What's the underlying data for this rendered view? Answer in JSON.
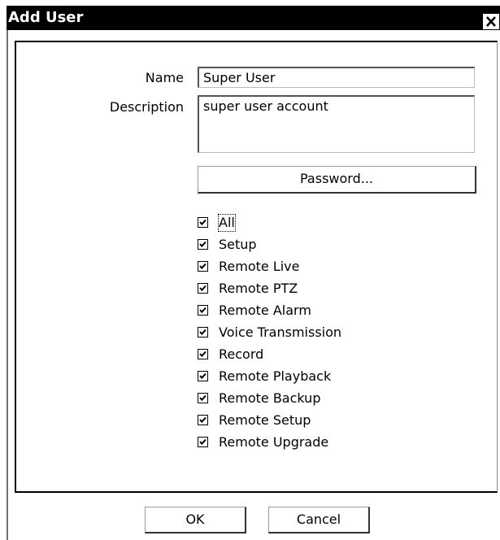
{
  "window": {
    "title": "Add User",
    "close_icon": "close-icon"
  },
  "form": {
    "name_label": "Name",
    "name_value": "Super User",
    "description_label": "Description",
    "description_value": "super user account",
    "password_button": "Password..."
  },
  "permissions": [
    {
      "label": "All",
      "checked": true
    },
    {
      "label": "Setup",
      "checked": true
    },
    {
      "label": "Remote Live",
      "checked": true
    },
    {
      "label": "Remote PTZ",
      "checked": true
    },
    {
      "label": "Remote Alarm",
      "checked": true
    },
    {
      "label": "Voice Transmission",
      "checked": true
    },
    {
      "label": "Record",
      "checked": true
    },
    {
      "label": "Remote Playback",
      "checked": true
    },
    {
      "label": "Remote Backup",
      "checked": true
    },
    {
      "label": "Remote Setup",
      "checked": true
    },
    {
      "label": "Remote Upgrade",
      "checked": true
    }
  ],
  "footer": {
    "ok_label": "OK",
    "cancel_label": "Cancel"
  }
}
